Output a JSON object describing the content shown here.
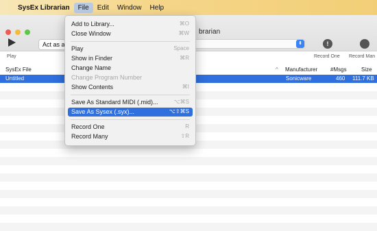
{
  "menubar": {
    "apple": "",
    "app_name": "SysEx Librarian",
    "menus": [
      "File",
      "Edit",
      "Window",
      "Help"
    ]
  },
  "window": {
    "title": "brarian",
    "traffic": [
      "#ee5b52",
      "#f4bb3a",
      "#5fc64a"
    ],
    "act_as": "Act as a",
    "play_label": "Play",
    "record_one_label": "Record One",
    "record_many_label": "Record Man",
    "select_chevron": "⬍",
    "record_one_glyph": "!"
  },
  "table": {
    "headers": {
      "file": "SysEx File",
      "manufacturer": "Manufacturer",
      "msgs": "#Msgs",
      "size": "Size",
      "sort": "^"
    },
    "rows": [
      {
        "file": "Untitled",
        "manufacturer": "Sonicware",
        "msgs": "460",
        "size": "111.7 KB"
      }
    ]
  },
  "file_menu": [
    {
      "label": "Add to Library...",
      "shortcut": "⌘O"
    },
    {
      "label": "Close Window",
      "shortcut": "⌘W"
    },
    {
      "label": "Play",
      "shortcut": "Space"
    },
    {
      "label": "Show in Finder",
      "shortcut": "⌘R"
    },
    {
      "label": "Change Name",
      "shortcut": ""
    },
    {
      "label": "Change Program Number",
      "shortcut": ""
    },
    {
      "label": "Show Contents",
      "shortcut": "⌘I"
    },
    {
      "label": "Save As Standard MIDI (.mid)...",
      "shortcut": "⌥⌘S"
    },
    {
      "label": "Save As Sysex (.syx)...",
      "shortcut": "⌥⇧⌘S"
    },
    {
      "label": "Record One",
      "shortcut": "R"
    },
    {
      "label": "Record Many",
      "shortcut": "⇧R"
    }
  ]
}
